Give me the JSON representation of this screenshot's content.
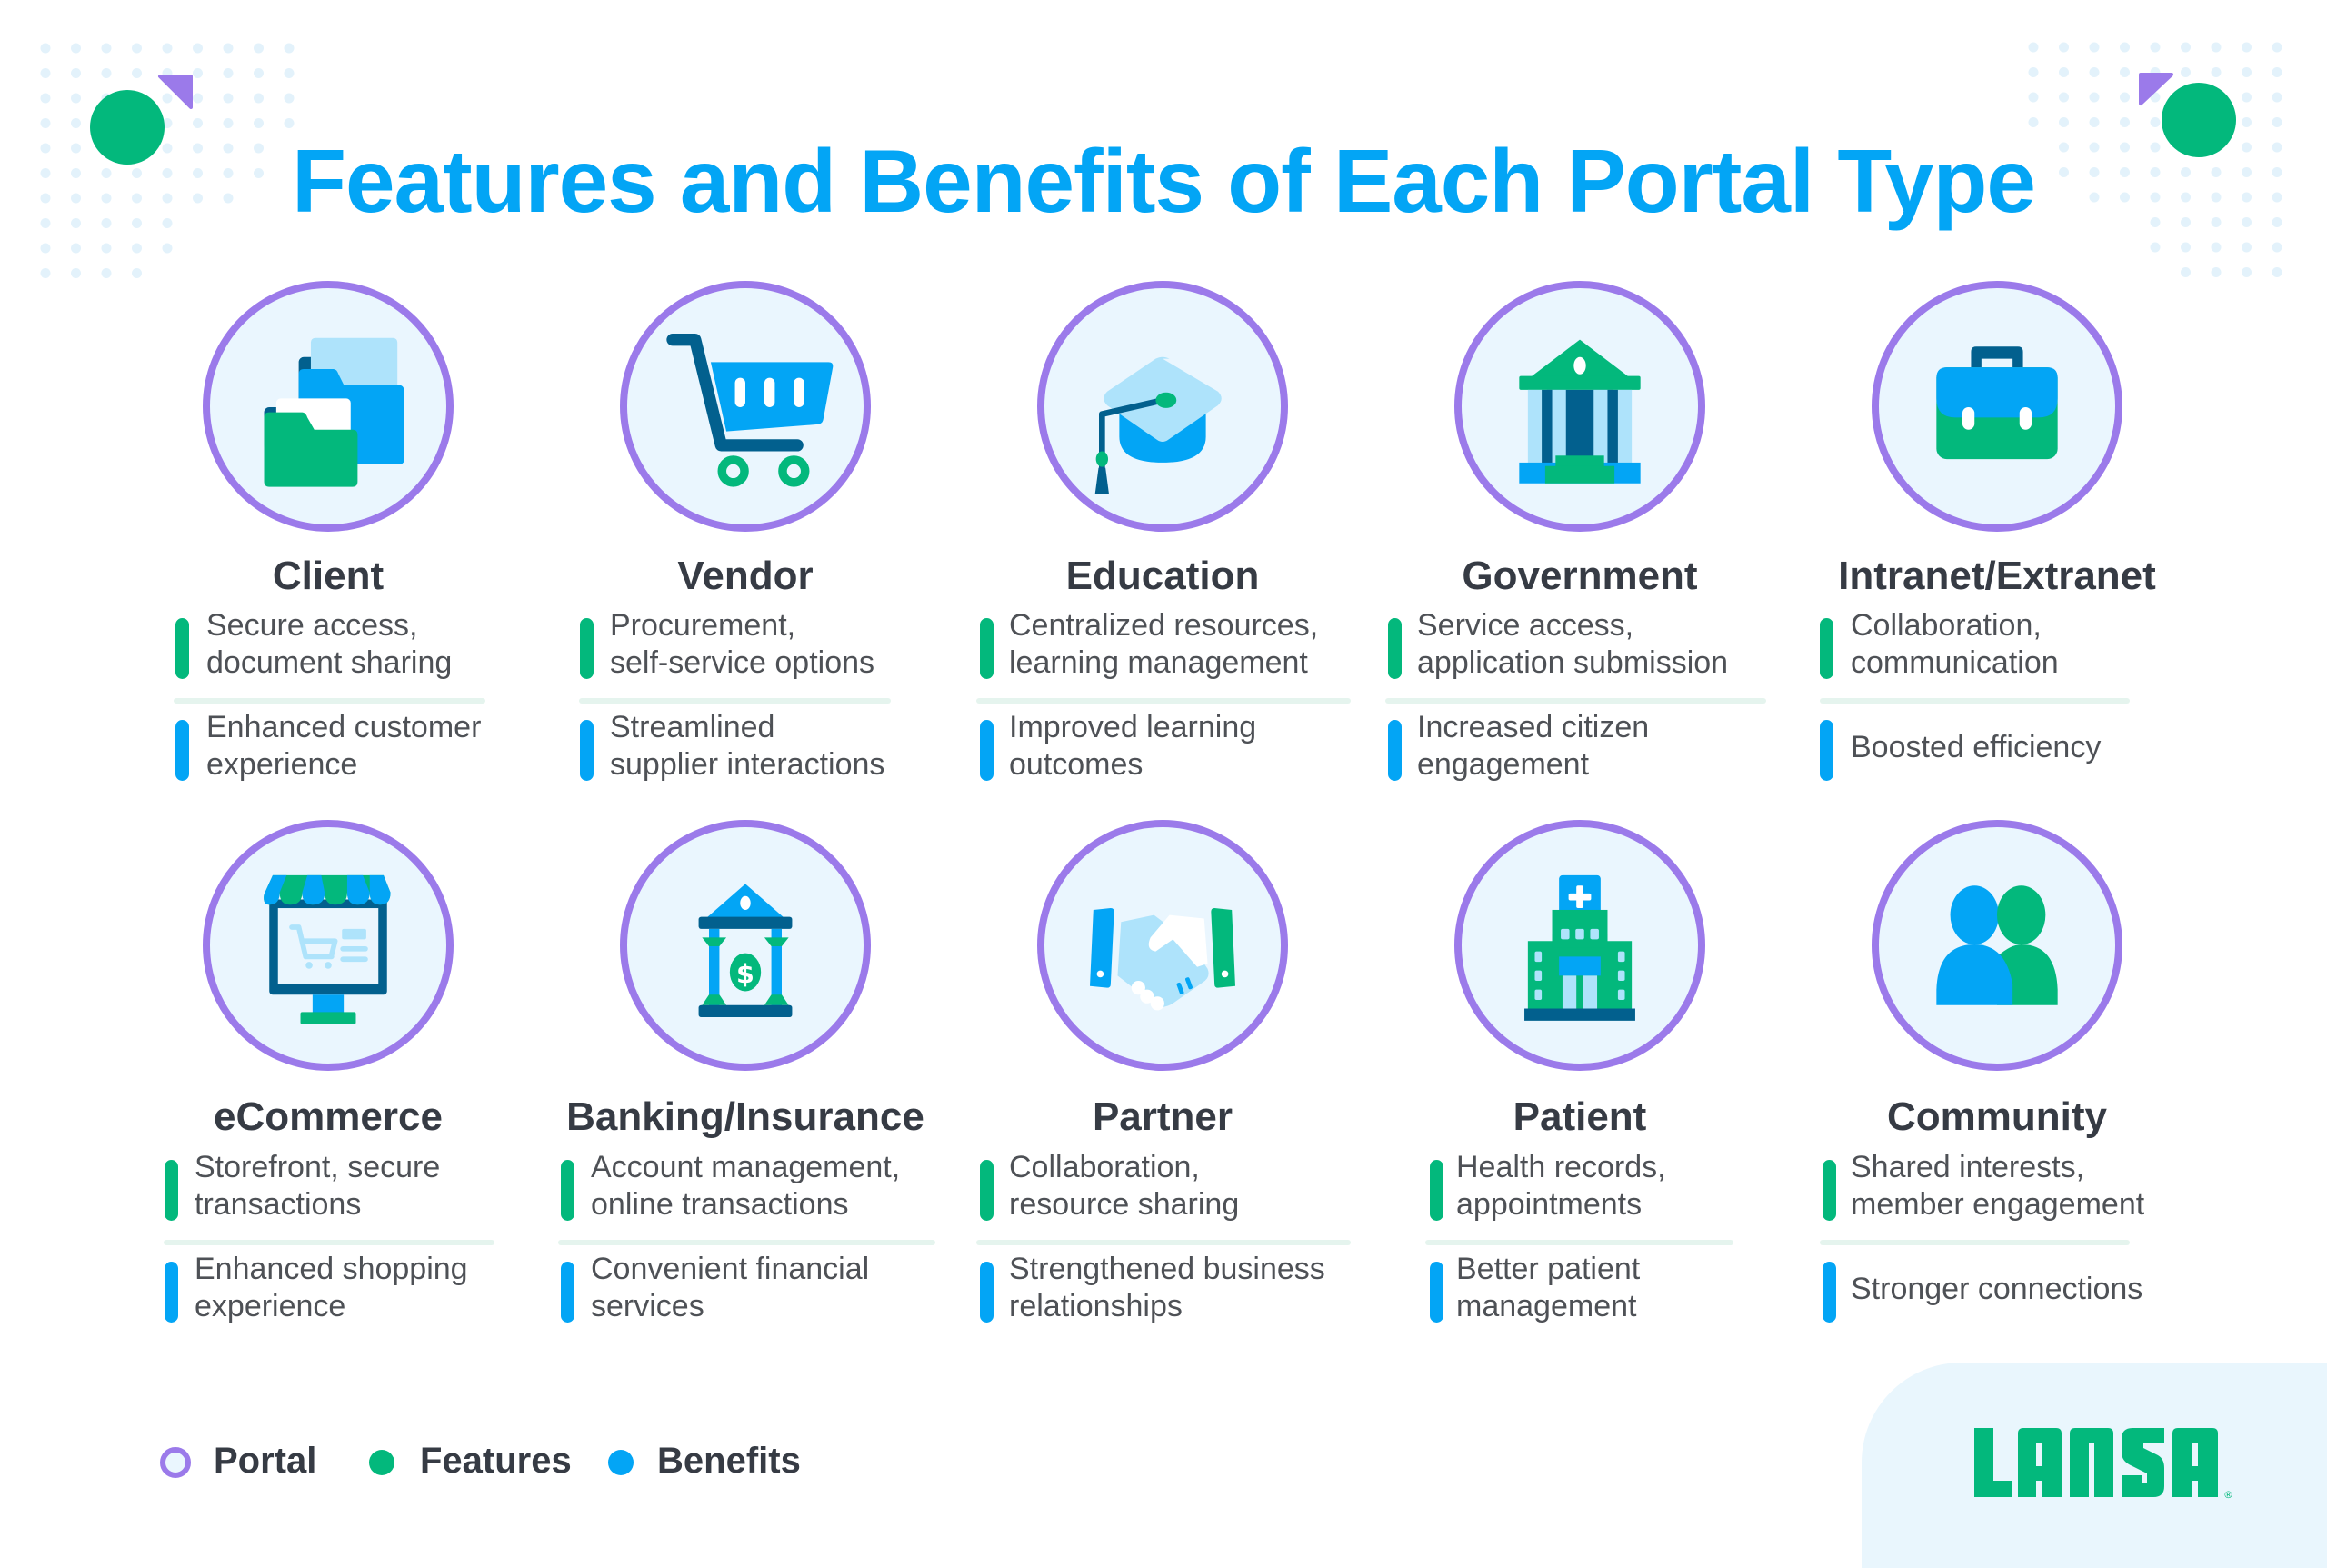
{
  "title": "Features and Benefits of Each Portal Type",
  "colors": {
    "title": "#03a5f5",
    "portal_ring": "#9b7aea",
    "features": "#03b87c",
    "benefits": "#03a5f5",
    "heading_text": "#363b44",
    "body_text": "#4e5156",
    "logo": "#03b87c",
    "panel": "#e9f6fd",
    "dots": "#e3f2fb"
  },
  "portals": [
    {
      "name": "Client",
      "icon": "folders-icon",
      "feature_lines": [
        "Secure access,",
        "document sharing"
      ],
      "benefit_lines": [
        "Enhanced customer",
        "experience"
      ]
    },
    {
      "name": "Vendor",
      "icon": "shopping-cart-icon",
      "feature_lines": [
        "Procurement,",
        "self-service options"
      ],
      "benefit_lines": [
        "Streamlined",
        "supplier interactions"
      ]
    },
    {
      "name": "Education",
      "icon": "graduation-cap-icon",
      "feature_lines": [
        "Centralized resources,",
        "learning management"
      ],
      "benefit_lines": [
        "Improved learning",
        "outcomes"
      ]
    },
    {
      "name": "Government",
      "icon": "government-building-icon",
      "feature_lines": [
        "Service access,",
        "application submission"
      ],
      "benefit_lines": [
        "Increased citizen",
        "engagement"
      ]
    },
    {
      "name": "Intranet/Extranet",
      "icon": "briefcase-icon",
      "feature_lines": [
        "Collaboration,",
        "communication"
      ],
      "benefit_lines": [
        "Boosted efficiency"
      ]
    },
    {
      "name": "eCommerce",
      "icon": "storefront-monitor-icon",
      "feature_lines": [
        "Storefront, secure",
        "transactions"
      ],
      "benefit_lines": [
        "Enhanced shopping",
        "experience"
      ]
    },
    {
      "name": "Banking/Insurance",
      "icon": "bank-dollar-icon",
      "feature_lines": [
        "Account management,",
        "online transactions"
      ],
      "benefit_lines": [
        "Convenient financial",
        "services"
      ]
    },
    {
      "name": "Partner",
      "icon": "handshake-icon",
      "feature_lines": [
        "Collaboration,",
        "resource sharing"
      ],
      "benefit_lines": [
        "Strengthened business",
        "relationships"
      ]
    },
    {
      "name": "Patient",
      "icon": "hospital-icon",
      "feature_lines": [
        "Health records,",
        "appointments"
      ],
      "benefit_lines": [
        "Better patient",
        "management"
      ]
    },
    {
      "name": "Community",
      "icon": "people-group-icon",
      "feature_lines": [
        "Shared interests,",
        "member engagement"
      ],
      "benefit_lines": [
        "Stronger connections"
      ]
    }
  ],
  "legend": [
    {
      "label": "Portal",
      "type": "ring"
    },
    {
      "label": "Features",
      "type": "dot"
    },
    {
      "label": "Benefits",
      "type": "dot"
    }
  ],
  "logo": {
    "text": "LANSA",
    "mark": "®"
  }
}
